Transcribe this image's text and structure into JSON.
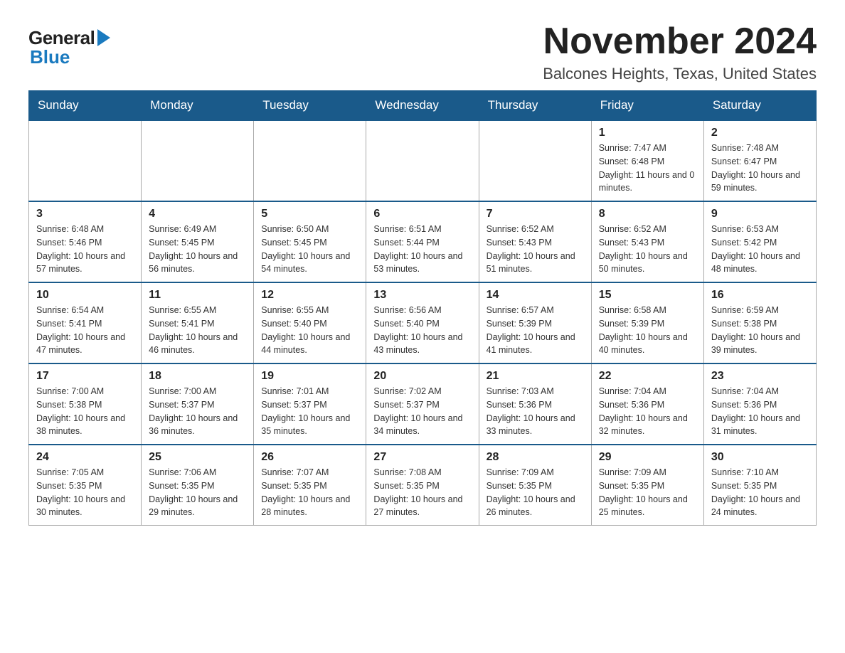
{
  "logo": {
    "general": "General",
    "blue": "Blue"
  },
  "header": {
    "month_title": "November 2024",
    "location": "Balcones Heights, Texas, United States"
  },
  "weekdays": [
    "Sunday",
    "Monday",
    "Tuesday",
    "Wednesday",
    "Thursday",
    "Friday",
    "Saturday"
  ],
  "weeks": [
    [
      {
        "day": "",
        "info": ""
      },
      {
        "day": "",
        "info": ""
      },
      {
        "day": "",
        "info": ""
      },
      {
        "day": "",
        "info": ""
      },
      {
        "day": "",
        "info": ""
      },
      {
        "day": "1",
        "info": "Sunrise: 7:47 AM\nSunset: 6:48 PM\nDaylight: 11 hours and 0 minutes."
      },
      {
        "day": "2",
        "info": "Sunrise: 7:48 AM\nSunset: 6:47 PM\nDaylight: 10 hours and 59 minutes."
      }
    ],
    [
      {
        "day": "3",
        "info": "Sunrise: 6:48 AM\nSunset: 5:46 PM\nDaylight: 10 hours and 57 minutes."
      },
      {
        "day": "4",
        "info": "Sunrise: 6:49 AM\nSunset: 5:45 PM\nDaylight: 10 hours and 56 minutes."
      },
      {
        "day": "5",
        "info": "Sunrise: 6:50 AM\nSunset: 5:45 PM\nDaylight: 10 hours and 54 minutes."
      },
      {
        "day": "6",
        "info": "Sunrise: 6:51 AM\nSunset: 5:44 PM\nDaylight: 10 hours and 53 minutes."
      },
      {
        "day": "7",
        "info": "Sunrise: 6:52 AM\nSunset: 5:43 PM\nDaylight: 10 hours and 51 minutes."
      },
      {
        "day": "8",
        "info": "Sunrise: 6:52 AM\nSunset: 5:43 PM\nDaylight: 10 hours and 50 minutes."
      },
      {
        "day": "9",
        "info": "Sunrise: 6:53 AM\nSunset: 5:42 PM\nDaylight: 10 hours and 48 minutes."
      }
    ],
    [
      {
        "day": "10",
        "info": "Sunrise: 6:54 AM\nSunset: 5:41 PM\nDaylight: 10 hours and 47 minutes."
      },
      {
        "day": "11",
        "info": "Sunrise: 6:55 AM\nSunset: 5:41 PM\nDaylight: 10 hours and 46 minutes."
      },
      {
        "day": "12",
        "info": "Sunrise: 6:55 AM\nSunset: 5:40 PM\nDaylight: 10 hours and 44 minutes."
      },
      {
        "day": "13",
        "info": "Sunrise: 6:56 AM\nSunset: 5:40 PM\nDaylight: 10 hours and 43 minutes."
      },
      {
        "day": "14",
        "info": "Sunrise: 6:57 AM\nSunset: 5:39 PM\nDaylight: 10 hours and 41 minutes."
      },
      {
        "day": "15",
        "info": "Sunrise: 6:58 AM\nSunset: 5:39 PM\nDaylight: 10 hours and 40 minutes."
      },
      {
        "day": "16",
        "info": "Sunrise: 6:59 AM\nSunset: 5:38 PM\nDaylight: 10 hours and 39 minutes."
      }
    ],
    [
      {
        "day": "17",
        "info": "Sunrise: 7:00 AM\nSunset: 5:38 PM\nDaylight: 10 hours and 38 minutes."
      },
      {
        "day": "18",
        "info": "Sunrise: 7:00 AM\nSunset: 5:37 PM\nDaylight: 10 hours and 36 minutes."
      },
      {
        "day": "19",
        "info": "Sunrise: 7:01 AM\nSunset: 5:37 PM\nDaylight: 10 hours and 35 minutes."
      },
      {
        "day": "20",
        "info": "Sunrise: 7:02 AM\nSunset: 5:37 PM\nDaylight: 10 hours and 34 minutes."
      },
      {
        "day": "21",
        "info": "Sunrise: 7:03 AM\nSunset: 5:36 PM\nDaylight: 10 hours and 33 minutes."
      },
      {
        "day": "22",
        "info": "Sunrise: 7:04 AM\nSunset: 5:36 PM\nDaylight: 10 hours and 32 minutes."
      },
      {
        "day": "23",
        "info": "Sunrise: 7:04 AM\nSunset: 5:36 PM\nDaylight: 10 hours and 31 minutes."
      }
    ],
    [
      {
        "day": "24",
        "info": "Sunrise: 7:05 AM\nSunset: 5:35 PM\nDaylight: 10 hours and 30 minutes."
      },
      {
        "day": "25",
        "info": "Sunrise: 7:06 AM\nSunset: 5:35 PM\nDaylight: 10 hours and 29 minutes."
      },
      {
        "day": "26",
        "info": "Sunrise: 7:07 AM\nSunset: 5:35 PM\nDaylight: 10 hours and 28 minutes."
      },
      {
        "day": "27",
        "info": "Sunrise: 7:08 AM\nSunset: 5:35 PM\nDaylight: 10 hours and 27 minutes."
      },
      {
        "day": "28",
        "info": "Sunrise: 7:09 AM\nSunset: 5:35 PM\nDaylight: 10 hours and 26 minutes."
      },
      {
        "day": "29",
        "info": "Sunrise: 7:09 AM\nSunset: 5:35 PM\nDaylight: 10 hours and 25 minutes."
      },
      {
        "day": "30",
        "info": "Sunrise: 7:10 AM\nSunset: 5:35 PM\nDaylight: 10 hours and 24 minutes."
      }
    ]
  ]
}
